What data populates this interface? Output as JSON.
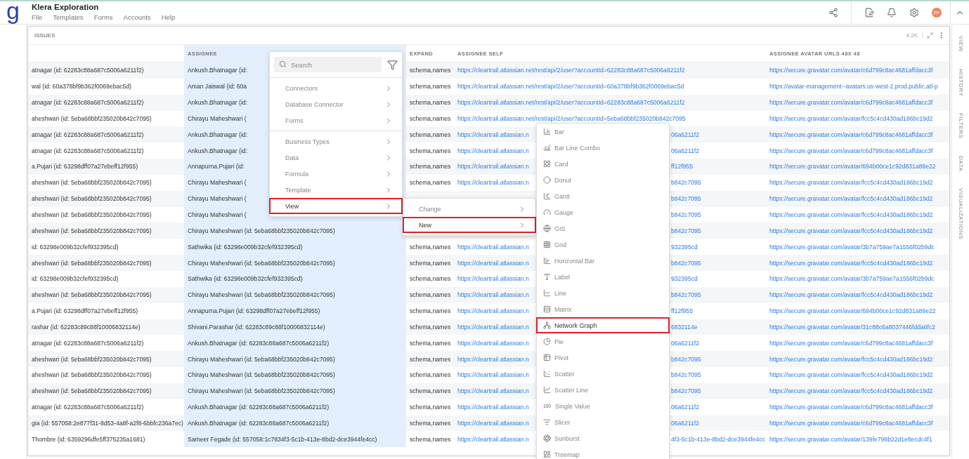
{
  "app": {
    "logo": "g",
    "title": "Klera Exploration",
    "menu": [
      "File",
      "Templates",
      "Forms",
      "Accounts",
      "Help"
    ],
    "avatar_initials": "PP"
  },
  "side_tabs": [
    "VIEW",
    "HISTORY",
    "FILTERS",
    "DATA",
    "VISUALIZATIONS"
  ],
  "panel": {
    "title": "ISSUES",
    "count": "4.2K"
  },
  "table": {
    "columns": [
      {
        "label": "ASSIGNEE",
        "highlighted": true
      },
      {
        "label": "EXPAND",
        "highlighted": false
      },
      {
        "label": "ASSIGNEE SELF",
        "highlighted": false
      },
      {
        "label": "ASSIGNEE AVATAR URLS 48X 48",
        "highlighted": false
      }
    ],
    "rows": [
      {
        "column_1": "atnagar (id: 62283c88a687c5006a6211f2)",
        "assignee": "Ankush.Bhatnagar (id:",
        "expand": "schema,names",
        "self_start": "https://cleartrail.atlassian.net/rest/api/2/user?accountId=62283c88a687c5006a6211f2",
        "avatar": "https://secure.gravatar.com/avatar/c6d799c8ac4681affdacc3f"
      },
      {
        "column_1": "wal (id: 60a378bf9b362f0069ebac5d)",
        "assignee": "Aman Jaiswal (id: 60a",
        "expand": "schema,names",
        "self_start": "https://cleartrail.atlassian.net/rest/api/2/user?accountId=60a378bf9b362f0069ebac5d",
        "avatar": "https://avatar-management--avatars.us-west-2.prod.public.atl-p"
      },
      {
        "column_1": "atnagar (id: 62283c88a687c5006a6211f2)",
        "assignee": "Ankush.Bhatnagar (id:",
        "expand": "schema,names",
        "self_start": "https://cleartrail.atlassian.net/rest/api/2/user?accountId=62283c88a687c5006a6211f2",
        "avatar": "https://secure.gravatar.com/avatar/c6d799c8ac4681affdacc3f"
      },
      {
        "column_1": "aheshwari (id: 5eba68bbf235020b842c7095)",
        "assignee": "Chirayu Maheshwari (",
        "expand": "schema,names",
        "self_start": "https://cleartrail.atlassian.net/rest/api/2/user?accountId=5eba68bbf235020b842c7095",
        "avatar": "https://secure.gravatar.com/avatar/fcc5c4cd430ad186bc19d2"
      },
      {
        "column_1": "atnagar (id: 62283c88a687c5006a6211f2)",
        "assignee": "Ankush.Bhatnagar (id:",
        "expand": "schema,names",
        "self_start": "https://cleartrail.atlassian.n",
        "self_end": "06a6211f2",
        "avatar": "https://secure.gravatar.com/avatar/c6d799c8ac4681affdacc3f"
      },
      {
        "column_1": "atnagar (id: 62283c88a687c5006a6211f2)",
        "assignee": "Ankush.Bhatnagar (id:",
        "expand": "schema,names",
        "self_start": "https://cleartrail.atlassian.n",
        "self_end": "06a6211f2",
        "avatar": "https://secure.gravatar.com/avatar/c6d799c8ac4681affdacc3f"
      },
      {
        "column_1": "a.Pujari (id: 63298dff07a27ebeff12f955)",
        "assignee": "Annapurna.Pujari (id:",
        "expand": "schema,names",
        "self_start": "https://cleartrail.atlassian.n",
        "self_end": "ff12f955",
        "avatar": "https://secure.gravatar.com/avatar/694b00ce1c92d831a89e22"
      },
      {
        "column_1": "aheshwari (id: 5eba68bbf235020b842c7095)",
        "assignee": "Chirayu Maheshwari (",
        "expand": "schema,names",
        "self_start": "https://cleartrail.atlassian.n",
        "self_end": "b842c7095",
        "avatar": "https://secure.gravatar.com/avatar/fcc5c4cd430ad186bc19d2"
      },
      {
        "column_1": "aheshwari (id: 5eba68bbf235020b842c7095)",
        "assignee": "Chirayu Maheshwari (",
        "self_end": "b842c7095",
        "avatar": "https://secure.gravatar.com/avatar/fcc5c4cd430ad186bc19d2"
      },
      {
        "column_1": "aheshwari (id: 5eba68bbf235020b842c7095)",
        "assignee": "Chirayu Maheshwari (",
        "self_end": "b842c7095",
        "avatar": "https://secure.gravatar.com/avatar/fcc5c4cd430ad186bc19d2"
      },
      {
        "column_1": "aheshwari (id: 5eba68bbf235020b842c7095)",
        "assignee": "Chirayu Maheshwari (id: 5eba68bbf235020b842c7095)",
        "self_end": "b842c7095",
        "avatar": "https://secure.gravatar.com/avatar/fcc5c4cd430ad186bc19d2"
      },
      {
        "column_1": "id: 63298e009b32cfef932395cd)",
        "assignee": "Sathwika (id: 63298e009b32cfef932395cd)",
        "expand": "schema,names",
        "self_start": "https://cleartrail.atlassian.n",
        "self_end": "932395cd",
        "avatar": "https://secure.gravatar.com/avatar/3b7a759ae7a1556f02b9dc"
      },
      {
        "column_1": "aheshwari (id: 5eba68bbf235020b842c7095)",
        "assignee": "Chirayu Maheshwari (id: 5eba68bbf235020b842c7095)",
        "expand": "schema,names",
        "self_start": "https://cleartrail.atlassian.n",
        "self_end": "b842c7095",
        "avatar": "https://secure.gravatar.com/avatar/fcc5c4cd430ad186bc19d2"
      },
      {
        "column_1": "id: 63298e009b32cfef932395cd)",
        "assignee": "Sathwika (id: 63298e009b32cfef932395cd)",
        "expand": "schema,names",
        "self_start": "https://cleartrail.atlassian.n",
        "self_end": "932395cd",
        "avatar": "https://secure.gravatar.com/avatar/3b7a759ae7a1556f02b9dc"
      },
      {
        "column_1": "aheshwari (id: 5eba68bbf235020b842c7095)",
        "assignee": "Chirayu Maheshwari (id: 5eba68bbf235020b842c7095)",
        "expand": "schema,names",
        "self_start": "https://cleartrail.atlassian.n",
        "self_end": "b842c7095",
        "avatar": "https://secure.gravatar.com/avatar/fcc5c4cd430ad186bc19d2"
      },
      {
        "column_1": "a.Pujari (id: 63298dff07a27ebeff12f955)",
        "assignee": "Annapurna.Pujari (id: 63298dff07a27ebeff12f955)",
        "expand": "schema,names",
        "self_start": "https://cleartrail.atlassian.n",
        "self_end": "ff12f955",
        "avatar": "https://secure.gravatar.com/avatar/694b00ce1c92d831a89e22"
      },
      {
        "column_1": "rashar (id: 62283c89c88f10006832114e)",
        "assignee": "Shivani.Parashar (id: 62283c89c88f10006832114e)",
        "expand": "schema,names",
        "self_start": "https://cleartrail.atlassian.n",
        "self_end": "6832114e",
        "avatar": "https://secure.gravatar.com/avatar/31c88c6a8037446fdda6fc2"
      },
      {
        "column_1": "atnagar (id: 62283c88a687c5006a6211f2)",
        "assignee": "Ankush.Bhatnagar (id: 62283c88a687c5006a6211f2)",
        "expand": "schema,names",
        "self_start": "https://cleartrail.atlassian.n",
        "self_end": "06a6211f2",
        "avatar": "https://secure.gravatar.com/avatar/c6d799c8ac4681affdacc3f"
      },
      {
        "column_1": "aheshwari (id: 5eba68bbf235020b842c7095)",
        "assignee": "Chirayu Maheshwari (id: 5eba68bbf235020b842c7095)",
        "expand": "schema,names",
        "self_start": "https://cleartrail.atlassian.n",
        "self_end": "b842c7095",
        "avatar": "https://secure.gravatar.com/avatar/fcc5c4cd430ad186bc19d2"
      },
      {
        "column_1": "aheshwari (id: 5eba68bbf235020b842c7095)",
        "assignee": "Chirayu Maheshwari (id: 5eba68bbf235020b842c7095)",
        "expand": "schema,names",
        "self_start": "https://cleartrail.atlassian.n",
        "self_end": "b842c7095",
        "avatar": "https://secure.gravatar.com/avatar/fcc5c4cd430ad186bc19d2"
      },
      {
        "column_1": "aheshwari (id: 5eba68bbf235020b842c7095)",
        "assignee": "Chirayu Maheshwari (id: 5eba68bbf235020b842c7095)",
        "expand": "schema,names",
        "self_start": "https://cleartrail.atlassian.n",
        "self_end": "b842c7095",
        "avatar": "https://secure.gravatar.com/avatar/fcc5c4cd430ad186bc19d2"
      },
      {
        "column_1": "atnagar (id: 62283c88a687c5006a6211f2)",
        "assignee": "Ankush.Bhatnagar (id: 62283c88a687c5006a6211f2)",
        "expand": "schema,names",
        "self_start": "https://cleartrail.atlassian.n",
        "self_end": "06a6211f2",
        "avatar": "https://secure.gravatar.com/avatar/c6d799c8ac4681affdacc3f"
      },
      {
        "column_1": "gia (id: 557058:2e877f31-8d53-4a8f-a2f8-6bbfc236a7ec)",
        "assignee": "Ankush.Bhatnagar (id: 62283c88a687c5006a6211f2)",
        "expand": "schema,names",
        "self_start": "https://cleartrail.atlassian.n",
        "self_end": "06a6211f2",
        "avatar": "https://secure.gravatar.com/avatar/c6d799c8ac4681affdacc3f"
      },
      {
        "column_1": "Thombre (id: 6359296dfe5ff375235a1681)",
        "assignee": "Sameer Fegade (id: 557058:1c7834f3-5c1b-413e-8bd2-dce3944fe4cc)",
        "expand": "schema,names",
        "self_start": "https://cleartrail.atlassian.n",
        "self_end": "4f3-5c1b-413e-8bd2-dce3944fe4cc",
        "avatar": "https://secure.gravatar.com/avatar/139fe798b22d1e8ecdc4f1"
      }
    ]
  },
  "context_menu": {
    "search": {
      "placeholder": "Search"
    },
    "groups": [
      [
        {
          "label": "Connectors",
          "highlighted": false
        },
        {
          "label": "Database Connector",
          "highlighted": false
        },
        {
          "label": "Forms",
          "highlighted": false
        }
      ],
      [
        {
          "label": "Business Types",
          "highlighted": false
        },
        {
          "label": "Data",
          "highlighted": false
        },
        {
          "label": "Formula",
          "highlighted": false
        },
        {
          "label": "Template",
          "highlighted": false
        },
        {
          "label": "View",
          "highlighted": true
        }
      ]
    ]
  },
  "view_submenu": {
    "items": [
      {
        "label": "Change",
        "highlighted": false
      },
      {
        "label": "New",
        "highlighted": true
      }
    ]
  },
  "visualization_menu": {
    "items": [
      {
        "label": "Bar",
        "kind": "bar",
        "highlighted": false
      },
      {
        "label": "Bar Line Combo",
        "kind": "combo",
        "highlighted": false
      },
      {
        "label": "Card",
        "kind": "card",
        "highlighted": false
      },
      {
        "label": "Donut",
        "kind": "donut",
        "highlighted": false
      },
      {
        "label": "Gantt",
        "kind": "gantt",
        "highlighted": false
      },
      {
        "label": "Gauge",
        "kind": "gauge",
        "highlighted": false
      },
      {
        "label": "GIS",
        "kind": "gis",
        "highlighted": false
      },
      {
        "label": "Grid",
        "kind": "grid",
        "highlighted": false
      },
      {
        "label": "Horizontal Bar",
        "kind": "hbar",
        "highlighted": false
      },
      {
        "label": "Label",
        "kind": "label",
        "highlighted": false
      },
      {
        "label": "Line",
        "kind": "line",
        "highlighted": false
      },
      {
        "label": "Matrix",
        "kind": "matrix",
        "highlighted": false
      },
      {
        "label": "Network Graph",
        "kind": "network",
        "highlighted": true
      },
      {
        "label": "Pie",
        "kind": "pie",
        "highlighted": false
      },
      {
        "label": "Pivot",
        "kind": "pivot",
        "highlighted": false
      },
      {
        "label": "Scatter",
        "kind": "scatter",
        "highlighted": false
      },
      {
        "label": "Scatter Line",
        "kind": "scatterline",
        "highlighted": false
      },
      {
        "label": "Single Value",
        "kind": "value",
        "icon_text": "100",
        "highlighted": false
      },
      {
        "label": "Slicer",
        "kind": "slicer",
        "highlighted": false
      },
      {
        "label": "Sunburst",
        "kind": "sunburst",
        "highlighted": false
      },
      {
        "label": "Treemap",
        "kind": "treemap",
        "highlighted": false
      }
    ]
  }
}
